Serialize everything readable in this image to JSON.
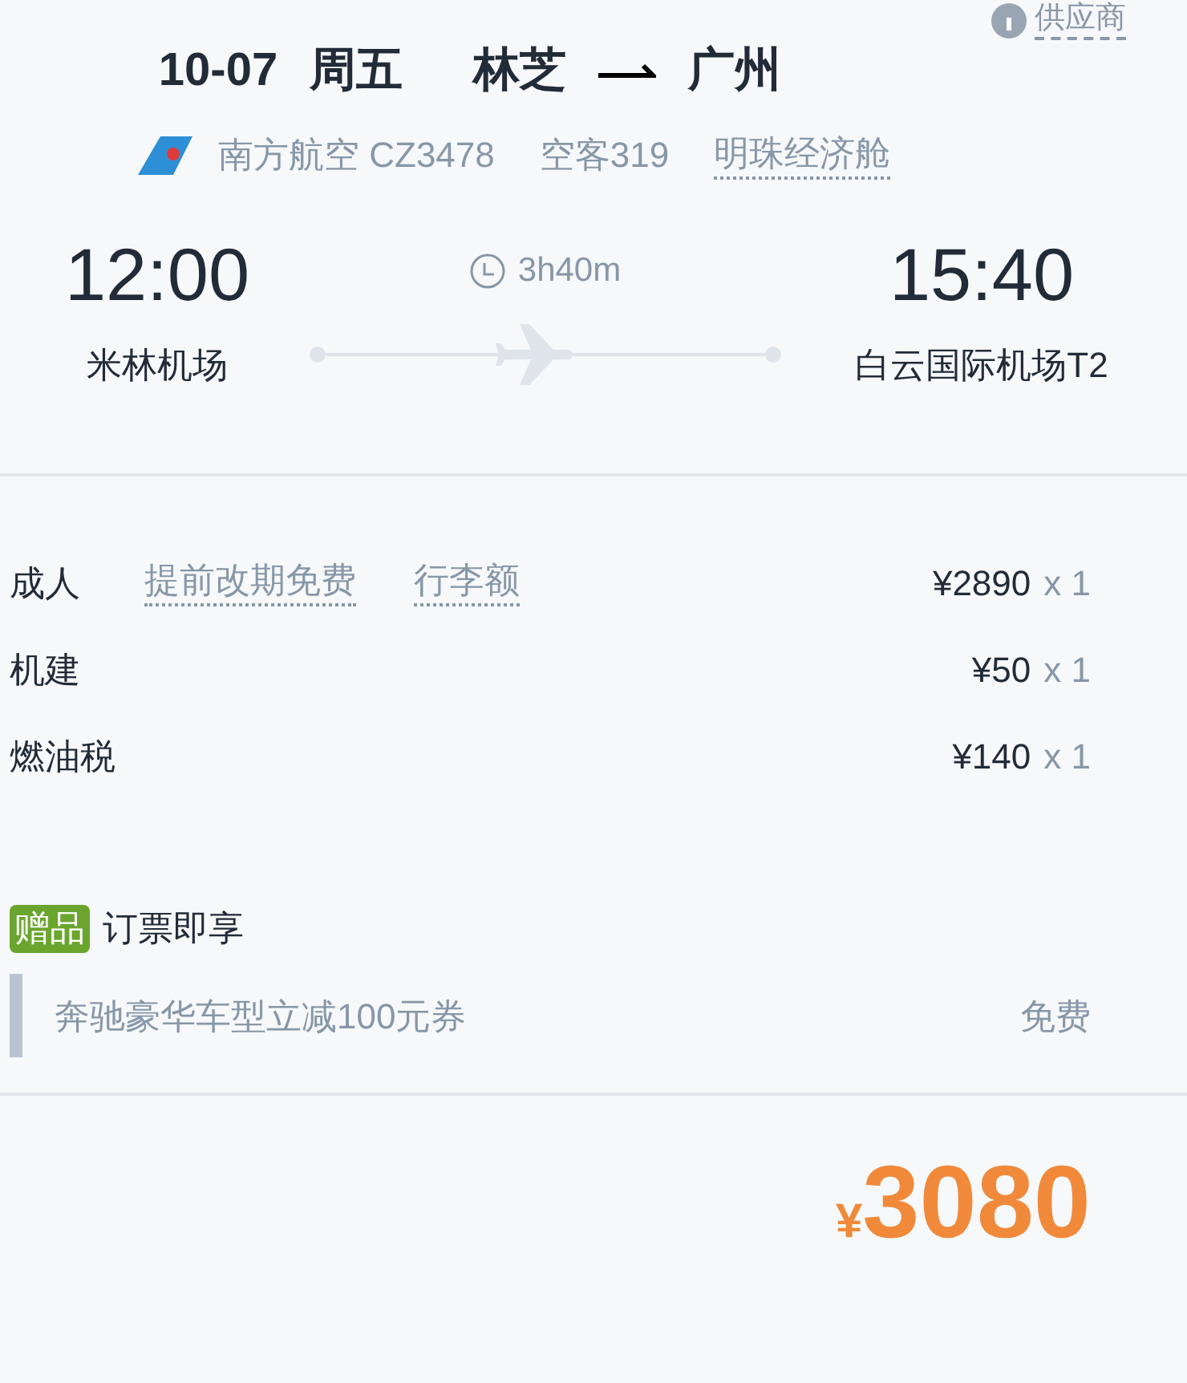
{
  "supplier_link": "供应商",
  "header": {
    "date": "10-07",
    "weekday": "周五",
    "origin": "林芝",
    "destination": "广州"
  },
  "flight_info": {
    "airline": "南方航空 CZ3478",
    "aircraft": "空客319",
    "cabin": "明珠经济舱"
  },
  "schedule": {
    "depart_time": "12:00",
    "depart_airport": "米林机场",
    "duration": "3h40m",
    "arrive_time": "15:40",
    "arrive_airport": "白云国际机场T2"
  },
  "fare_items": [
    {
      "name": "成人",
      "tags": [
        "提前改期免费",
        "行李额"
      ],
      "price": "¥2890",
      "quantity": "x 1"
    },
    {
      "name": "机建",
      "price": "¥50",
      "quantity": "x 1"
    },
    {
      "name": "燃油税",
      "price": "¥140",
      "quantity": "x 1"
    }
  ],
  "gift": {
    "badge": "赠品",
    "title": "订票即享",
    "item": "奔驰豪华车型立减100元券",
    "price": "免费"
  },
  "total": {
    "currency": "¥",
    "amount": "3080"
  }
}
